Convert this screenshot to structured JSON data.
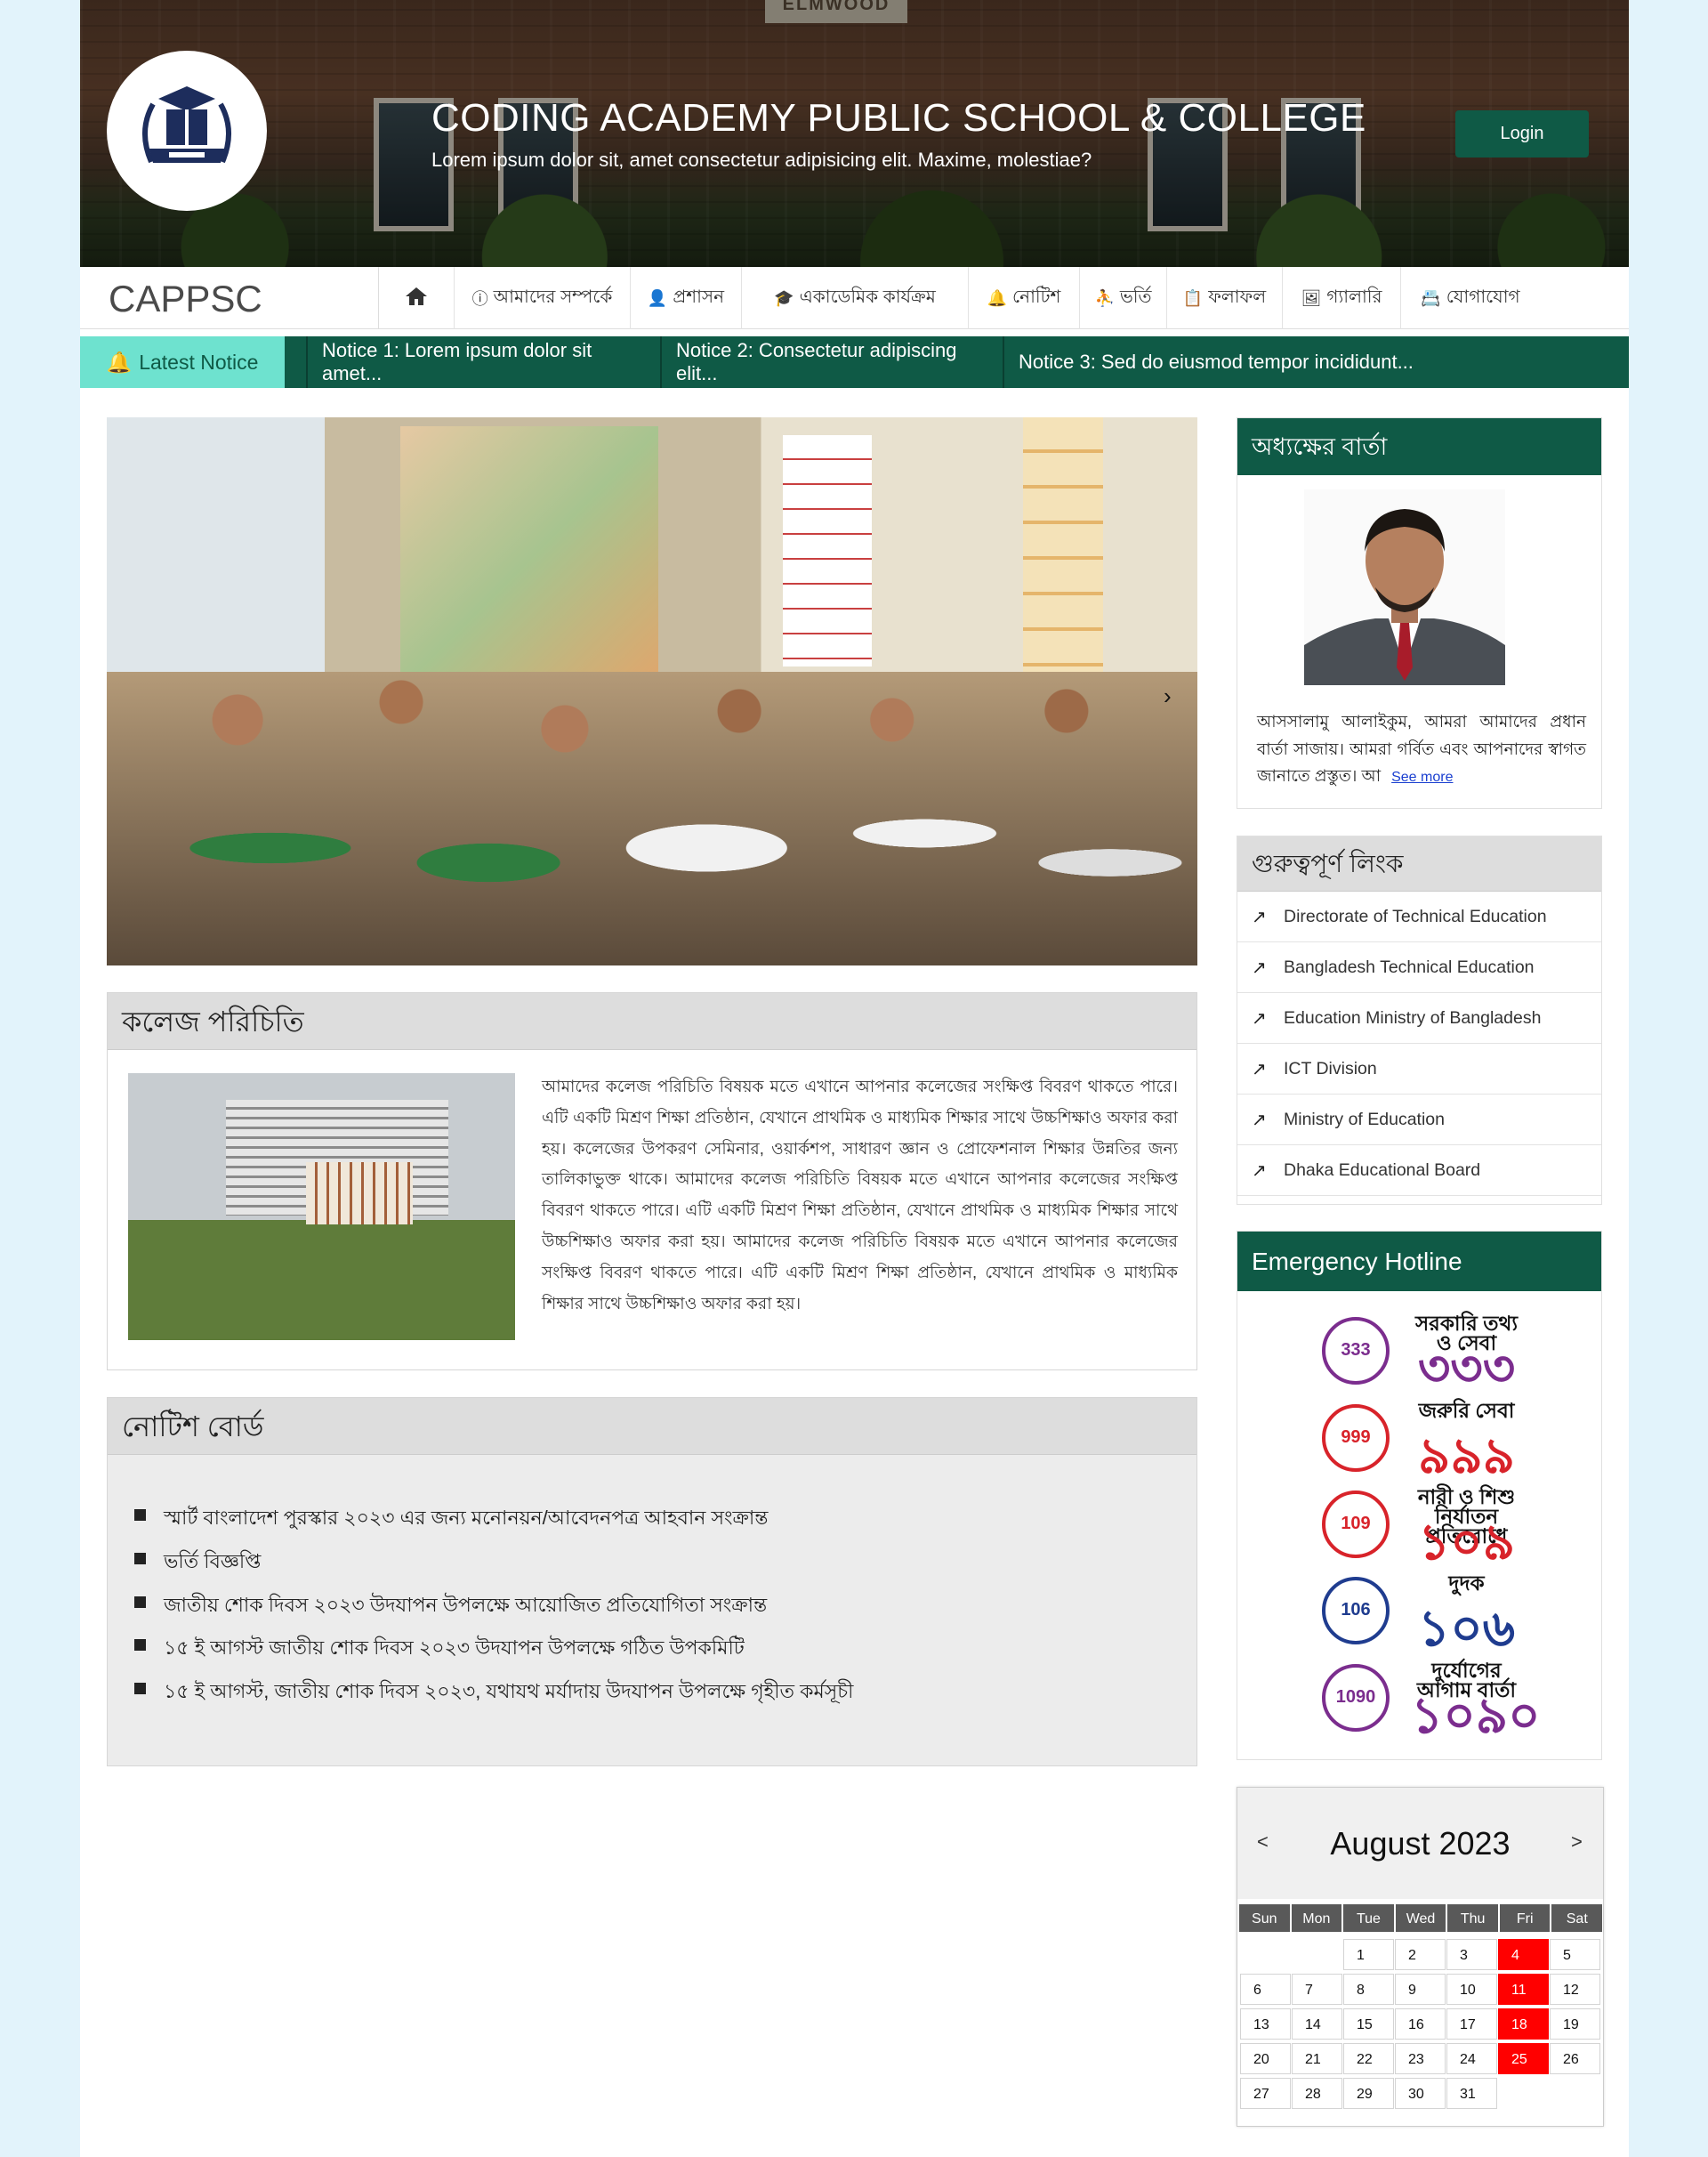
{
  "header": {
    "title": "CODING ACADEMY PUBLIC SCHOOL & COLLEGE",
    "subtitle": "Lorem ipsum dolor sit, amet consectetur adipisicing elit. Maxime, molestiae?",
    "login_label": "Login",
    "logo_icon": "school-book-logo",
    "building_sign": "ELMWOOD"
  },
  "nav": {
    "brand": "CAPPSC",
    "items": [
      {
        "icon": "home-icon",
        "label": ""
      },
      {
        "icon": "info-icon",
        "label": "আমাদের সম্পর্কে"
      },
      {
        "icon": "user-icon",
        "label": "প্রশাসন"
      },
      {
        "icon": "graduation-cap-icon",
        "label": "একাডেমিক কার্যক্রম"
      },
      {
        "icon": "bell-icon",
        "label": "নোটিশ"
      },
      {
        "icon": "person-board-icon",
        "label": "ভর্তি"
      },
      {
        "icon": "clipboard-check-icon",
        "label": "ফলাফল"
      },
      {
        "icon": "images-icon",
        "label": "গ্যালারি"
      },
      {
        "icon": "contact-icon",
        "label": "যোগাযোগ"
      }
    ]
  },
  "ticker": {
    "label": "Latest Notice",
    "items": [
      "Notice 1: Lorem ipsum dolor sit amet...",
      "Notice 2: Consectetur adipiscing elit...",
      "Notice 3: Sed do eiusmod tempor incididunt..."
    ]
  },
  "carousel": {
    "next_label": "›"
  },
  "intro": {
    "heading": "কলেজ পরিচিতি",
    "text": "আমাদের কলেজ পরিচিতি বিষয়ক মতে এখানে আপনার কলেজের সংক্ষিপ্ত বিবরণ থাকতে পারে। এটি একটি মিশ্রণ শিক্ষা প্রতিষ্ঠান, যেখানে প্রাথমিক ও মাধ্যমিক শিক্ষার সাথে উচ্চশিক্ষাও অফার করা হয়। কলেজের উপকরণ সেমিনার, ওয়ার্কশপ, সাধারণ জ্ঞান ও প্রোফেশনাল শিক্ষার উন্নতির জন্য তালিকাভুক্ত থাকে। আমাদের কলেজ পরিচিতি বিষয়ক মতে এখানে আপনার কলেজের সংক্ষিপ্ত বিবরণ থাকতে পারে। এটি একটি মিশ্রণ শিক্ষা প্রতিষ্ঠান, যেখানে প্রাথমিক ও মাধ্যমিক শিক্ষার সাথে উচ্চশিক্ষাও অফার করা হয়। আমাদের কলেজ পরিচিতি বিষয়ক মতে এখানে আপনার কলেজের সংক্ষিপ্ত বিবরণ থাকতে পারে। এটি একটি মিশ্রণ শিক্ষা প্রতিষ্ঠান, যেখানে প্রাথমিক ও মাধ্যমিক শিক্ষার সাথে উচ্চশিক্ষাও অফার করা হয়।"
  },
  "notice_board": {
    "heading": "নোটিশ বোর্ড",
    "items": [
      "স্মার্ট বাংলাদেশ পুরস্কার ২০২৩ এর জন্য মনোনয়ন/আবেদনপত্র আহবান সংক্রান্ত",
      "ভর্তি বিজ্ঞপ্তি",
      "জাতীয় শোক দিবস ২০২৩ উদযাপন উপলক্ষে আয়োজিত প্রতিযোগিতা সংক্রান্ত",
      "১৫ ই আগস্ট জাতীয় শোক দিবস ২০২৩ উদযাপন উপলক্ষে গঠিত উপকমিটি",
      "১৫ ই আগস্ট, জাতীয় শোক দিবস ২০২৩, যথাযথ মর্যাদায় উদযাপন উপলক্ষে গৃহীত কর্মসূচী"
    ]
  },
  "principal": {
    "heading": "অধ্যক্ষের বার্তা",
    "message": "আসসালামু আলাইকুম, আমরা আমাদের প্রধান বার্তা সাজায়। আমরা গর্বিত এবং আপনাদের স্বাগত জানাতে প্রস্তুত। আ",
    "see_more": "See more"
  },
  "links": {
    "heading": "গুরুত্বপূর্ণ লিংক",
    "items": [
      "Directorate of Technical Education",
      "Bangladesh Technical Education",
      "Education Ministry of Bangladesh",
      "ICT Division",
      "Ministry of Education",
      "Dhaka Educational Board"
    ]
  },
  "hotline": {
    "heading": "Emergency Hotline",
    "items": [
      {
        "label": "সরকারি তথ্য ও সেবা",
        "number": "৩৩৩",
        "badge": "333",
        "color": "#7b2d8e"
      },
      {
        "label": "জরুরি সেবা",
        "number": "৯৯৯",
        "badge": "999",
        "color": "#d8232a"
      },
      {
        "label": "নারী ও শিশু নির্যাতন প্রতিরোধে",
        "number": "১০৯",
        "badge": "109",
        "color": "#d8232a"
      },
      {
        "label": "দুদক",
        "number": "১০৬",
        "badge": "106",
        "color": "#1f3c8f"
      },
      {
        "label": "দুর্যোগের আগাম বার্তা",
        "number": "১০৯০",
        "badge": "1090",
        "color": "#7b2d8e"
      }
    ]
  },
  "calendar": {
    "month": "August 2023",
    "prev": "<",
    "next": ">",
    "days": [
      "Sun",
      "Mon",
      "Tue",
      "Wed",
      "Thu",
      "Fri",
      "Sat"
    ],
    "weeks": [
      [
        "",
        "",
        "1",
        "2",
        "3",
        "4",
        "5"
      ],
      [
        "6",
        "7",
        "8",
        "9",
        "10",
        "11",
        "12"
      ],
      [
        "13",
        "14",
        "15",
        "16",
        "17",
        "18",
        "19"
      ],
      [
        "20",
        "21",
        "22",
        "23",
        "24",
        "25",
        "26"
      ],
      [
        "27",
        "28",
        "29",
        "30",
        "31",
        "",
        ""
      ]
    ],
    "highlight_weekday": "Fri",
    "highlight_color": "#ff0000"
  },
  "colors": {
    "primary": "#0f5a46",
    "accent": "#6ee2cf",
    "page_bg": "#e2f3fb"
  }
}
